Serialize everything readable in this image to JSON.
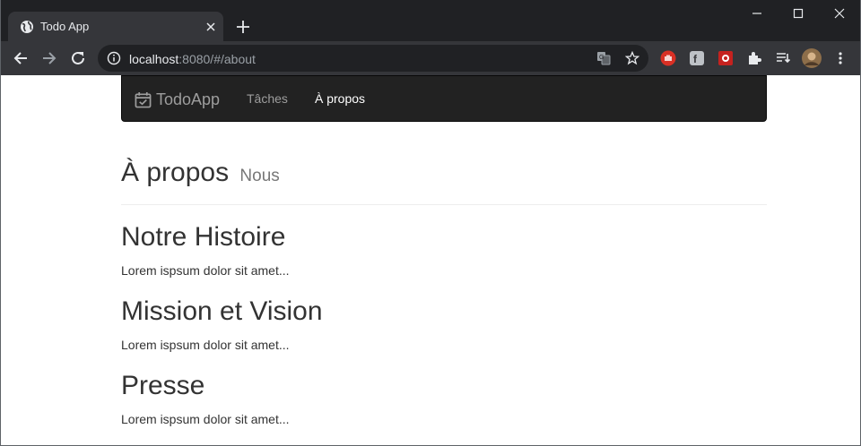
{
  "browser": {
    "tab": {
      "title": "Todo App"
    },
    "address": {
      "host": "localhost",
      "rest": ":8080/#/about"
    },
    "colors": {
      "tabstrip": "#202124",
      "toolbar": "#35363a",
      "omnibox": "#202124"
    },
    "icons": [
      "globe-icon",
      "close-icon",
      "plus-icon",
      "minimize-icon",
      "maximize-icon",
      "back-icon",
      "forward-icon",
      "reload-icon",
      "info-icon",
      "translate-icon",
      "star-icon",
      "stop-extension-icon",
      "extension-f-icon",
      "extension-red-icon",
      "puzzle-icon",
      "reading-list-icon",
      "avatar",
      "menu-icon"
    ]
  },
  "navbar": {
    "brand": "TodoApp",
    "links": [
      {
        "label": "Tâches",
        "active": false
      },
      {
        "label": "À propos",
        "active": true
      }
    ],
    "colors": {
      "background": "#222222",
      "link": "#9d9d9d",
      "active": "#ffffff"
    }
  },
  "header": {
    "title": "À propos",
    "subtitle": "Nous"
  },
  "sections": [
    {
      "title": "Notre Histoire",
      "text": "Lorem ispsum dolor sit amet..."
    },
    {
      "title": "Mission et Vision",
      "text": "Lorem ispsum dolor sit amet..."
    },
    {
      "title": "Presse",
      "text": "Lorem ispsum dolor sit amet..."
    }
  ]
}
